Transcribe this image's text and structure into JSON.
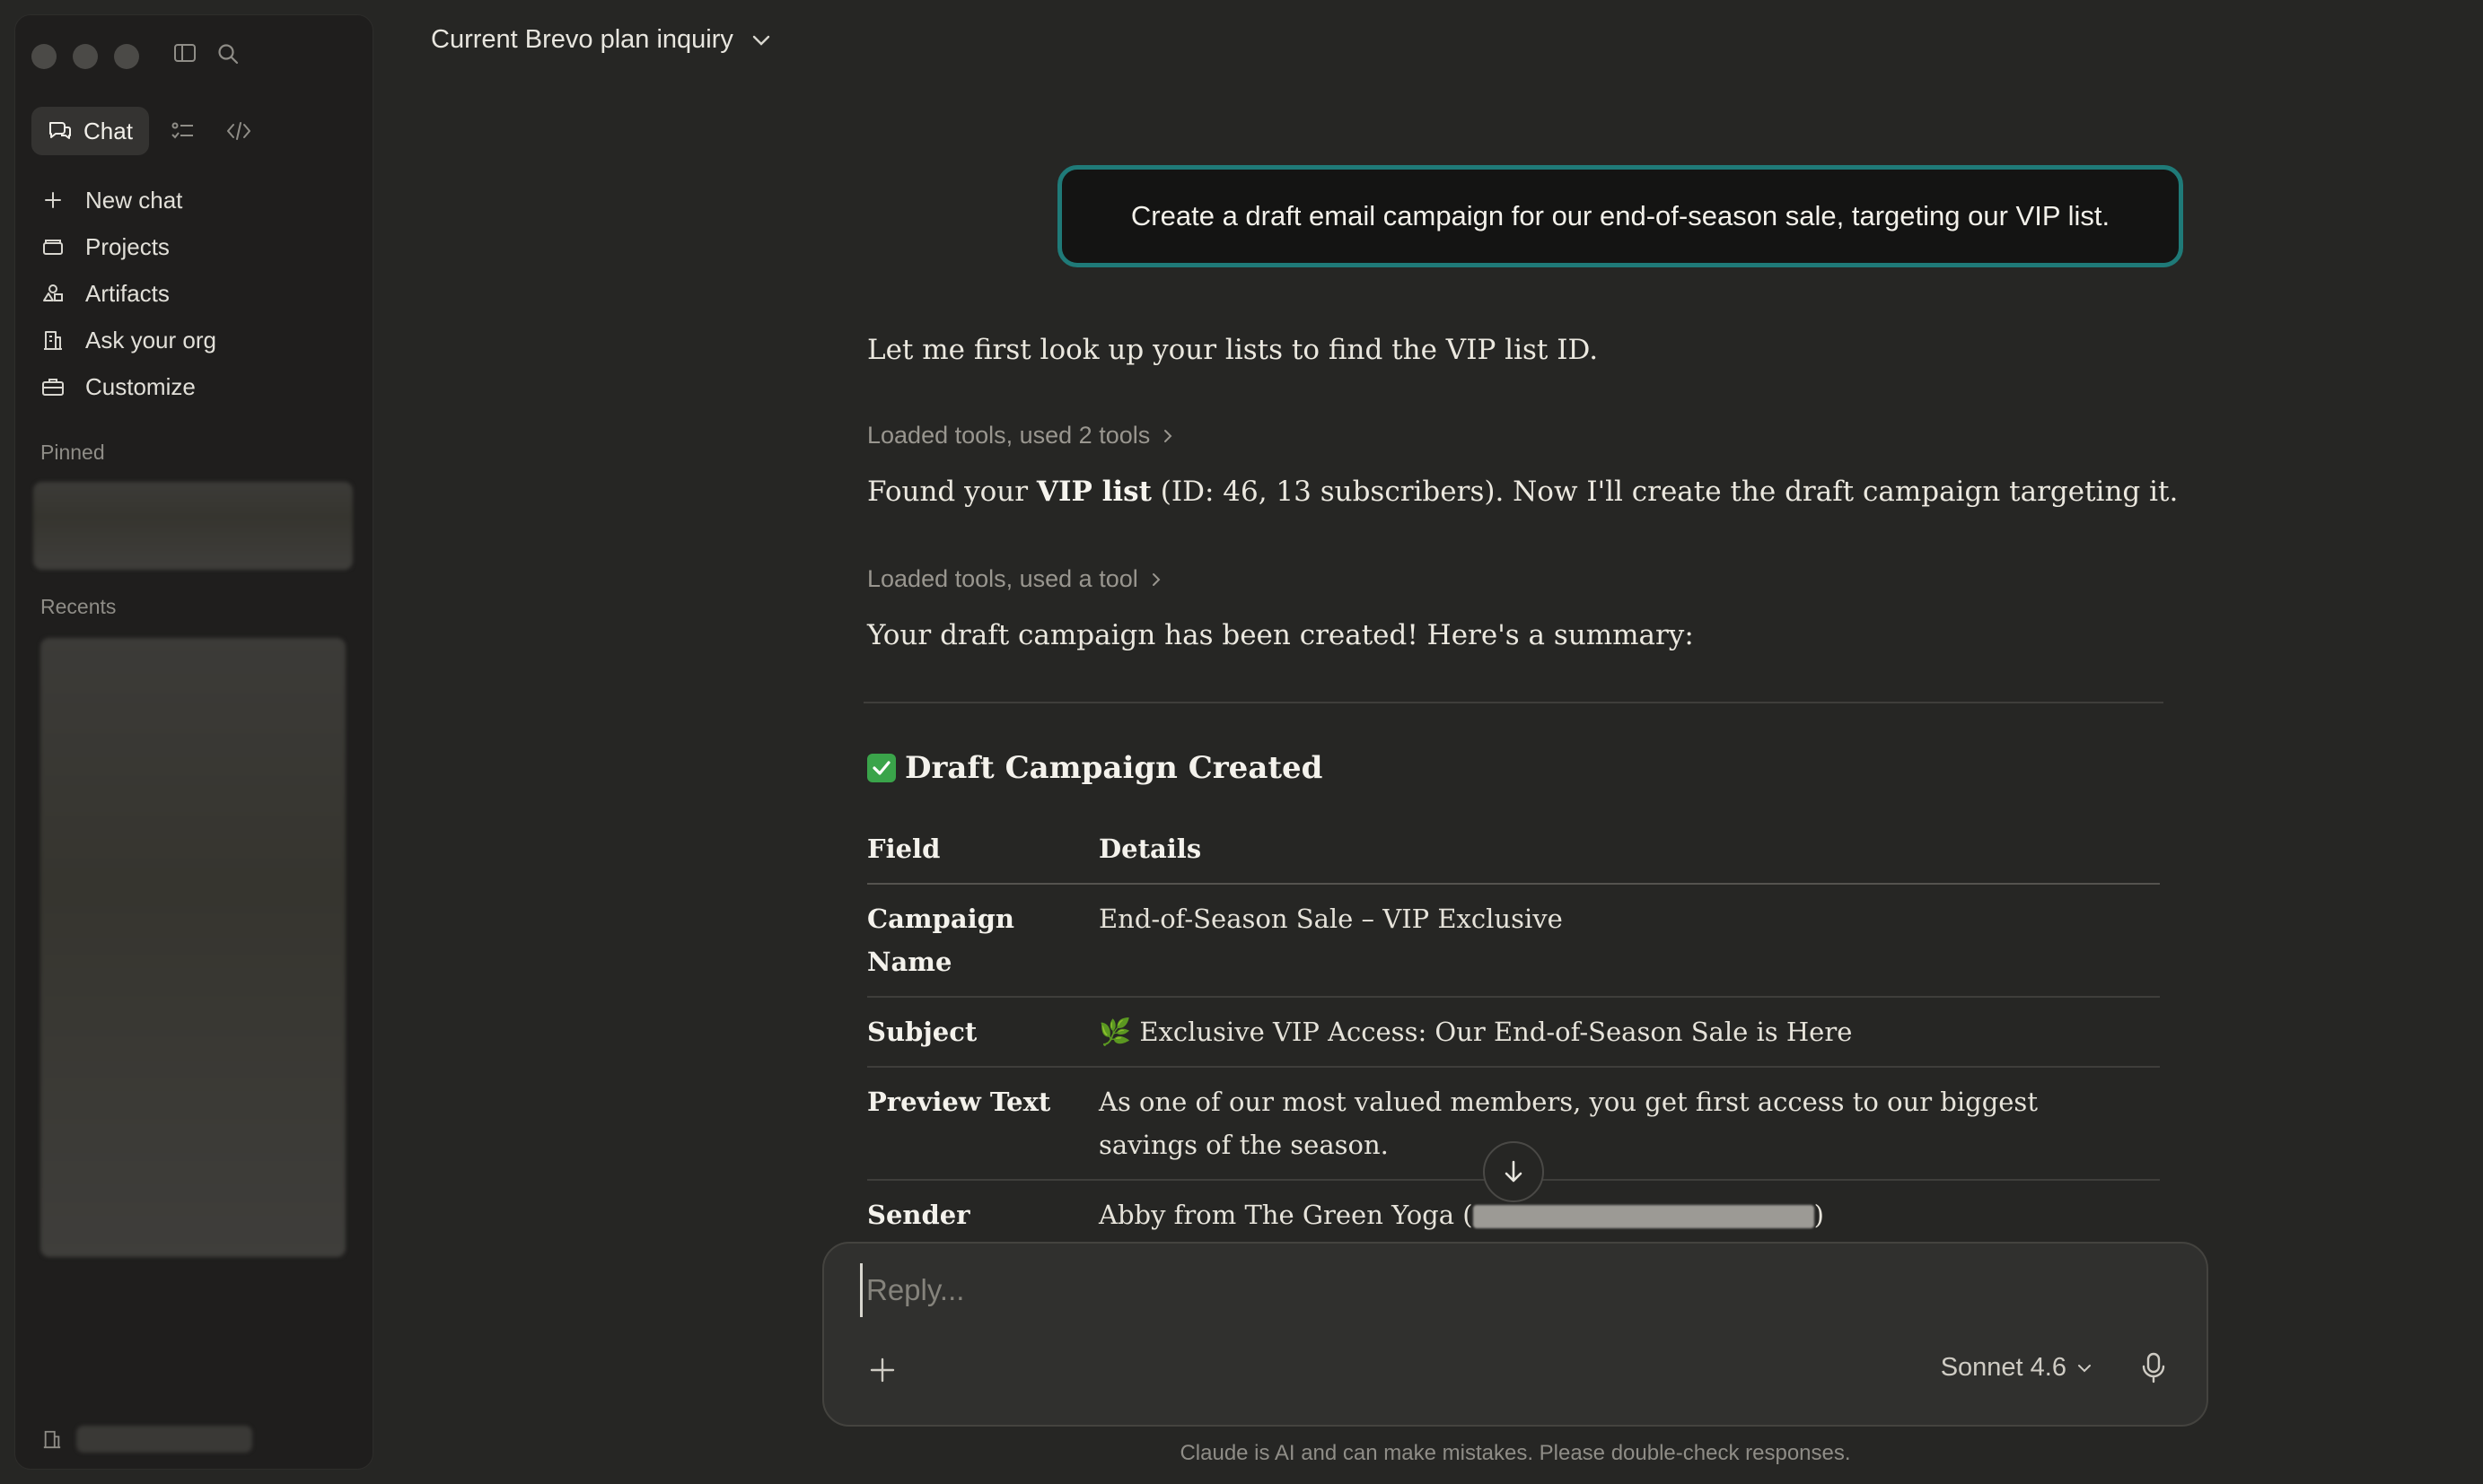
{
  "sidebar": {
    "mode_chat_label": "Chat",
    "nav": [
      {
        "label": "New chat",
        "icon": "plus-icon"
      },
      {
        "label": "Projects",
        "icon": "folder-icon"
      },
      {
        "label": "Artifacts",
        "icon": "artifacts-icon"
      },
      {
        "label": "Ask your org",
        "icon": "building-icon"
      },
      {
        "label": "Customize",
        "icon": "briefcase-icon"
      }
    ],
    "pinned_label": "Pinned",
    "recents_label": "Recents"
  },
  "header": {
    "title": "Current Brevo plan inquiry"
  },
  "conversation": {
    "user_message": "Create a draft email campaign for our end-of-season sale, targeting our VIP list.",
    "assistant_1": "Let me first look up your lists to find the VIP list ID.",
    "tool_1": "Loaded tools, used 2 tools",
    "assistant_2_prefix": "Found your ",
    "assistant_2_bold": "VIP list",
    "assistant_2_suffix": " (ID: 46, 13 subscribers). Now I'll create the draft campaign targeting it.",
    "tool_2": "Loaded tools, used a tool",
    "assistant_3": "Your draft campaign has been created! Here's a summary:",
    "heading": "Draft Campaign Created",
    "table": {
      "headers": [
        "Field",
        "Details"
      ],
      "rows": [
        {
          "field": "Campaign Name",
          "value": "End-of-Season Sale – VIP Exclusive"
        },
        {
          "field": "Subject",
          "value": "🌿 Exclusive VIP Access: Our End-of-Season Sale is Here"
        },
        {
          "field": "Preview Text",
          "value": "As one of our most valued members, you get first access to our biggest savings of the season."
        },
        {
          "field": "Sender",
          "value_prefix": "Abby from The Green Yoga (",
          "value_suffix": ")"
        }
      ]
    }
  },
  "composer": {
    "placeholder": "Reply...",
    "model": "Sonnet 4.6"
  },
  "footer": {
    "disclaimer": "Claude is AI and can make mistakes. Please double-check responses."
  },
  "colors": {
    "background": "#262624",
    "sidebar": "#1f1e1d",
    "accent_border": "#1f7a78",
    "check_green": "#3aa44a"
  }
}
